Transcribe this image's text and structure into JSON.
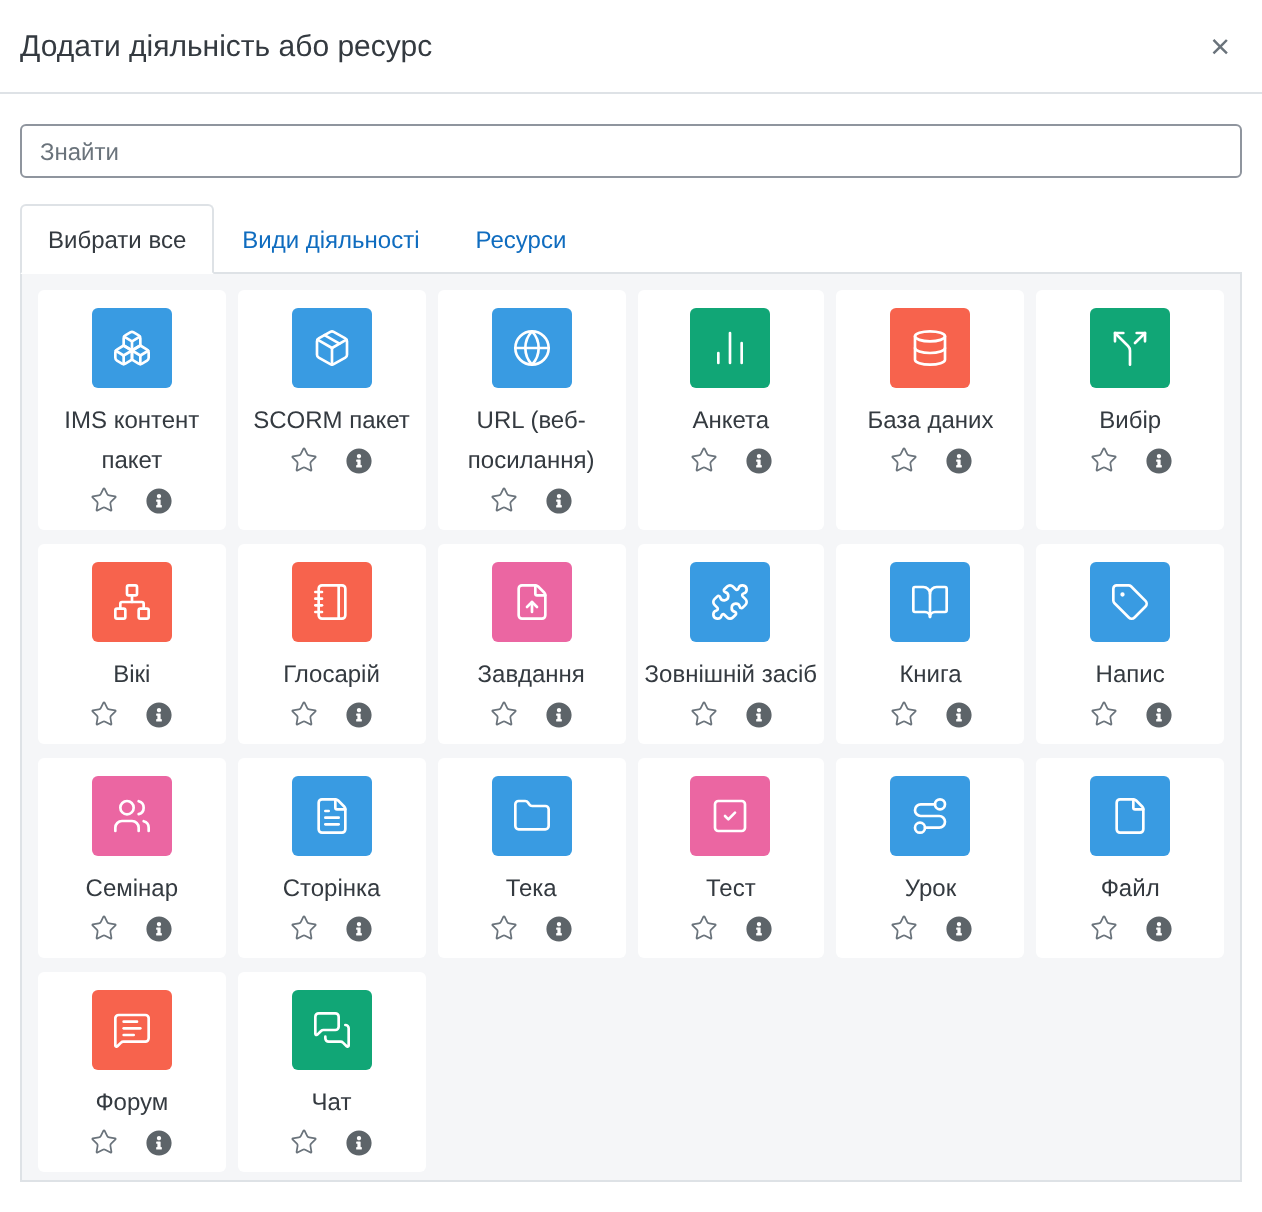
{
  "dialog": {
    "title": "Додати діяльність або ресурс",
    "close": "×"
  },
  "search": {
    "placeholder": "Знайти"
  },
  "tabs": [
    {
      "label": "Вибрати все",
      "selected": true
    },
    {
      "label": "Види діяльності",
      "selected": false
    },
    {
      "label": "Ресурси",
      "selected": false
    }
  ],
  "items": [
    {
      "name": "IMS контент пакет",
      "color": "#399be2"
    },
    {
      "name": "SCORM пакет",
      "color": "#399be2"
    },
    {
      "name": "URL (веб-посилання)",
      "color": "#399be2"
    },
    {
      "name": "Анкета",
      "color": "#11a676"
    },
    {
      "name": "База даних",
      "color": "#f7634d"
    },
    {
      "name": "Вибір",
      "color": "#11a676"
    },
    {
      "name": "Вікі",
      "color": "#f7634d"
    },
    {
      "name": "Глосарій",
      "color": "#f7634d"
    },
    {
      "name": "Завдання",
      "color": "#eb66a2"
    },
    {
      "name": "Зовнішній засіб",
      "color": "#399be2"
    },
    {
      "name": "Книга",
      "color": "#399be2"
    },
    {
      "name": "Напис",
      "color": "#399be2"
    },
    {
      "name": "Семінар",
      "color": "#eb66a2"
    },
    {
      "name": "Сторінка",
      "color": "#399be2"
    },
    {
      "name": "Тека",
      "color": "#399be2"
    },
    {
      "name": "Тест",
      "color": "#eb66a2"
    },
    {
      "name": "Урок",
      "color": "#399be2"
    },
    {
      "name": "Файл",
      "color": "#399be2"
    },
    {
      "name": "Форум",
      "color": "#f7634d"
    },
    {
      "name": "Чат",
      "color": "#11a676"
    }
  ]
}
